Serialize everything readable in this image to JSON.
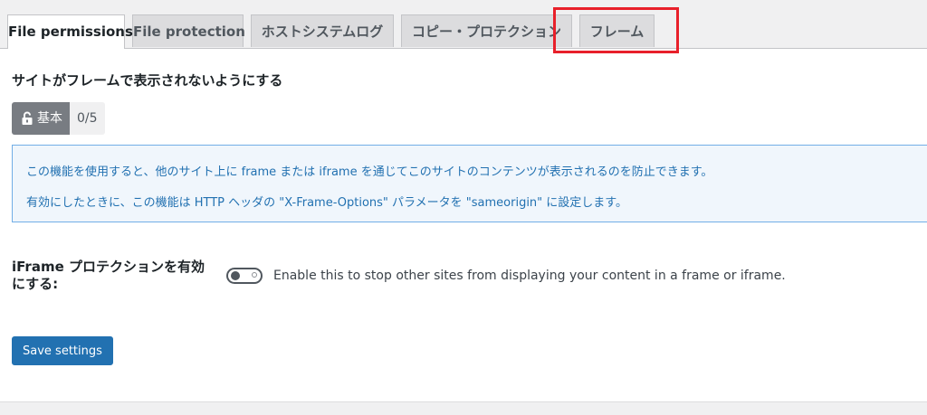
{
  "tabs": [
    {
      "label": "File permissions",
      "active": true
    },
    {
      "label": "File protection",
      "active": false
    },
    {
      "label": "ホストシステムログ",
      "active": false
    },
    {
      "label": "コピー・プロテクション",
      "active": false
    },
    {
      "label": "フレーム",
      "active": false
    }
  ],
  "section": {
    "title": "サイトがフレームで表示されないようにする"
  },
  "badge": {
    "level": "基本",
    "count": "0/5"
  },
  "info": {
    "line1": "この機能を使用すると、他のサイト上に frame または iframe を通じてこのサイトのコンテンツが表示されるのを防止できます。",
    "line2": "有効にしたときに、この機能は HTTP ヘッダの \"X-Frame-Options\" パラメータを \"sameorigin\" に設定します。"
  },
  "setting": {
    "label": "iFrame プロテクションを有効にする:",
    "description": "Enable this to stop other sites from displaying your content in a frame or iframe.",
    "enabled": false
  },
  "actions": {
    "save_label": "Save settings"
  },
  "colors": {
    "highlight": "#e8202a",
    "accent": "#2271b1",
    "badge": "#787c82"
  },
  "icons": {
    "badge_icon": "lock-open-icon"
  }
}
